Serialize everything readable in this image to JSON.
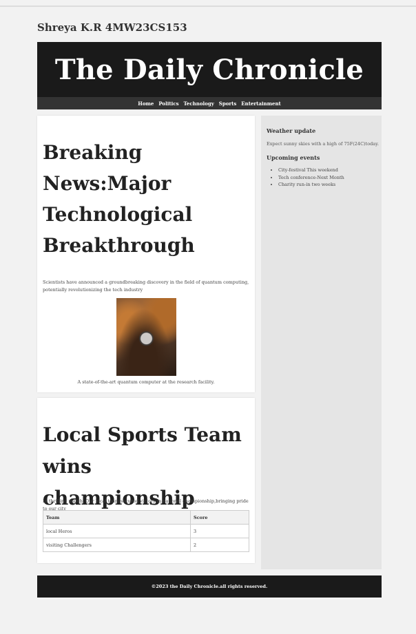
{
  "student": "Shreya K.R 4MW23CS153",
  "masthead": {
    "title": "The Daily Chronicle"
  },
  "nav": {
    "items": [
      "Home",
      "Politics",
      "Technology",
      "Sports",
      "Entertainment"
    ]
  },
  "article1": {
    "title": "Breaking News:Major Technological Breakthrough",
    "text": "Scientists have announced a groundbreaking discovery in the field of quantum computing, potentially revolutionizing the tech industry",
    "image_caption": "A state-of-the-art quantum computer at the research facility."
  },
  "article2": {
    "title": "Local Sports Team wins championship",
    "text": "In thrilling match. Our local team secured victory in national championship,bringing pride to our city",
    "table": {
      "headers": [
        "Team",
        "Score"
      ],
      "rows": [
        [
          "local Heros",
          "3"
        ],
        [
          "visiting Challengers",
          "2"
        ]
      ]
    }
  },
  "sidebar": {
    "weather_heading": "Weather update",
    "weather_text": "Expect sunny skies with a high of 75F(24C)today.",
    "events_heading": "Upcoming events",
    "events": [
      "City-festival This weekend",
      "Tech conference-Next Month",
      "Charity run-in two weeks"
    ]
  },
  "footer": {
    "text": "©2023 the Daily Chronicle.all rights reserved."
  },
  "colors": {
    "page_bg": "#f2f2f2",
    "header_bg": "#1a1a1a",
    "nav_bg": "#333333",
    "sidebar_bg": "#e5e5e5",
    "card_bg": "#ffffff"
  }
}
